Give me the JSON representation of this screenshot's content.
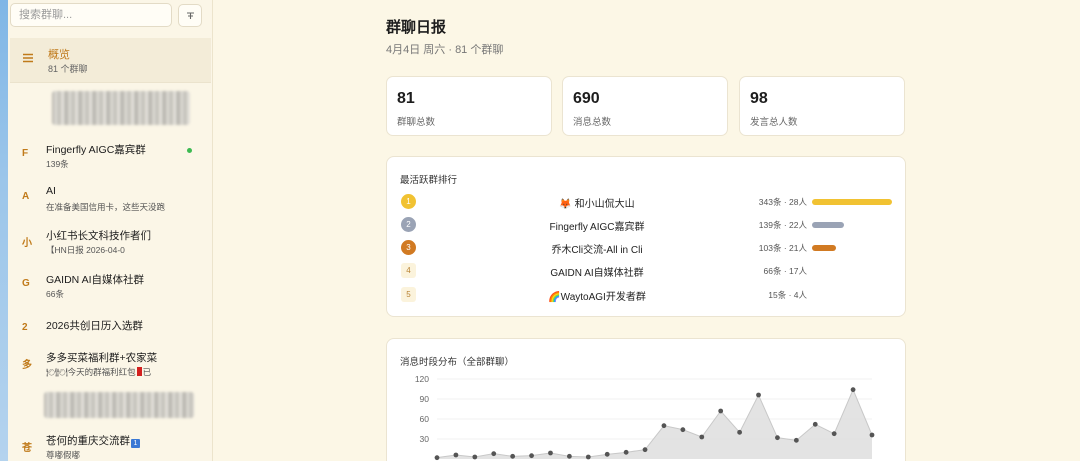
{
  "sidebar": {
    "search_placeholder": "搜索群聊...",
    "overview": {
      "title": "概览",
      "subtitle": "81 个群聊"
    },
    "groups": [
      {
        "avatar": "F",
        "name": "Fingerfly AIGC嘉宾群",
        "subtitle": "139条",
        "online": true
      },
      {
        "avatar": "A",
        "name": "AI",
        "subtitle": "在准备美国信用卡，这些天没跑"
      },
      {
        "avatar": "小",
        "name": "小红书长文科技作者们",
        "subtitle": "【HN日报 2026-04-0"
      },
      {
        "avatar": "G",
        "name": "GAIDN AI自媒体社群",
        "subtitle": "66条"
      },
      {
        "avatar": "2",
        "name": "2026共创日历入选群",
        "subtitle": ""
      },
      {
        "avatar": "多",
        "name": "多多买菜福利群+农家菜",
        "subtitle_before": "🍽🍽今天的群福利红包",
        "subtitle_after": "已"
      },
      {
        "avatar": "苍",
        "name": "苍何的重庆交流群",
        "badge": "1",
        "subtitle": "尊嘟假嘟"
      }
    ]
  },
  "header": {
    "title": "群聊日报",
    "subtitle": "4月4日 周六 · 81 个群聊"
  },
  "stats": [
    {
      "value": "81",
      "label": "群聊总数"
    },
    {
      "value": "690",
      "label": "消息总数"
    },
    {
      "value": "98",
      "label": "发言总人数"
    }
  ],
  "ranking": {
    "title": "最活跃群排行",
    "colors": {
      "gold": "#f1c232",
      "silver": "#9aa3b5",
      "bronze": "#d17a22"
    },
    "rows": [
      {
        "rank": "1",
        "name": "🦊 和小山侃大山",
        "stat": "343条 · 28人",
        "messages": 343
      },
      {
        "rank": "2",
        "name": "Fingerfly AIGC嘉宾群",
        "stat": "139条 · 22人",
        "messages": 139
      },
      {
        "rank": "3",
        "name": "乔木Cli交流-All in Cli",
        "stat": "103条 · 21人",
        "messages": 103
      },
      {
        "rank": "4",
        "name": "GAIDN AI自媒体社群",
        "stat": "66条 · 17人",
        "messages": 66
      },
      {
        "rank": "5",
        "name": "🌈WaytoAGI开发者群",
        "stat": "15条 · 4人",
        "messages": 15
      }
    ]
  },
  "chart_data": {
    "type": "area",
    "title": "消息时段分布（全部群聊）",
    "yticks": [
      120,
      90,
      60,
      30
    ],
    "ylim": [
      0,
      120
    ],
    "values": [
      2,
      6,
      3,
      8,
      4,
      5,
      9,
      4,
      3,
      7,
      10,
      14,
      50,
      44,
      33,
      72,
      40,
      96,
      32,
      28,
      52,
      38,
      104,
      36
    ],
    "fill_color": "#d9d9d9",
    "point_color": "#555555"
  }
}
